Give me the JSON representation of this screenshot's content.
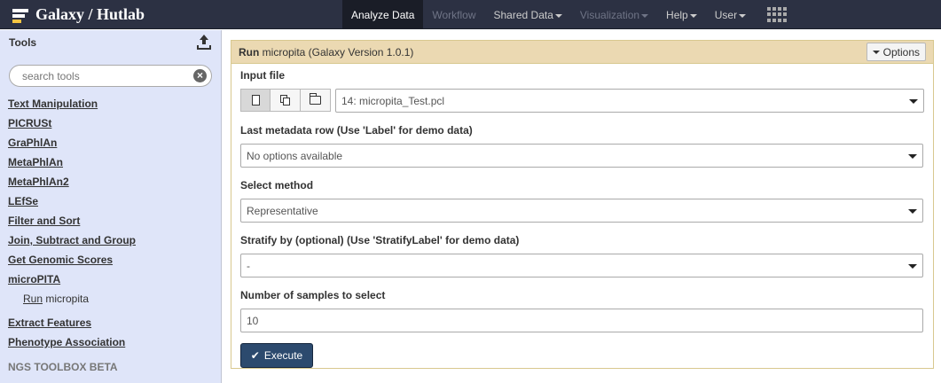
{
  "brand": {
    "title": "Galaxy / Hutlab"
  },
  "nav": {
    "items": [
      {
        "label": "Analyze Data",
        "state": "active"
      },
      {
        "label": "Workflow",
        "state": "disabled"
      },
      {
        "label": "Shared Data",
        "state": "normal",
        "dropdown": true
      },
      {
        "label": "Visualization",
        "state": "disabled",
        "dropdown": true
      },
      {
        "label": "Help",
        "state": "normal",
        "dropdown": true
      },
      {
        "label": "User",
        "state": "normal",
        "dropdown": true
      }
    ]
  },
  "tools_panel": {
    "title": "Tools",
    "search_placeholder": "search tools",
    "sections": [
      {
        "label": "Text Manipulation"
      },
      {
        "label": "PICRUSt"
      },
      {
        "label": "GraPhlAn"
      },
      {
        "label": "MetaPhlAn"
      },
      {
        "label": "MetaPhlAn2"
      },
      {
        "label": "LEfSe"
      },
      {
        "label": "Filter and Sort"
      },
      {
        "label": "Join, Subtract and Group"
      },
      {
        "label": "Get Genomic Scores"
      },
      {
        "label": "microPITA"
      }
    ],
    "open_tool": {
      "link": "Run",
      "text": " micropita"
    },
    "sections_after": [
      {
        "label": "Extract Features"
      },
      {
        "label": "Phenotype Association"
      }
    ],
    "footer_label": "NGS TOOLBOX BETA"
  },
  "form": {
    "run_label": "Run",
    "tool_name": " micropita (Galaxy Version 1.0.1)",
    "options_label": "Options",
    "fields": {
      "input_file": {
        "label": "Input file",
        "value": "14: micropita_Test.pcl"
      },
      "last_metadata": {
        "label": "Last metadata row (Use 'Label' for demo data)",
        "value": "No options available"
      },
      "method": {
        "label": "Select method",
        "value": "Representative"
      },
      "stratify": {
        "label": "Stratify by (optional) (Use 'StratifyLabel' for demo data)",
        "value": "-"
      },
      "num_samples": {
        "label": "Number of samples to select",
        "value": "10"
      }
    },
    "execute_label": "Execute"
  }
}
